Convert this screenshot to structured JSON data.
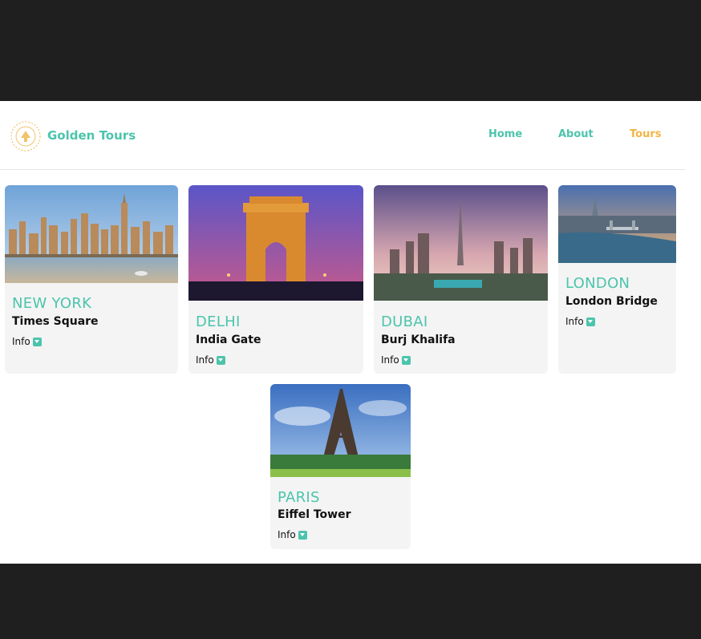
{
  "brand": {
    "name": "Golden Tours",
    "badge_text": "Golden Tours"
  },
  "nav": {
    "home": "Home",
    "about": "About",
    "tours": "Tours"
  },
  "colors": {
    "accent": "#4cc4ac",
    "active_nav": "#f2b544",
    "card_bg": "#f4f4f4"
  },
  "cards": [
    {
      "city": "NEW YORK",
      "landmark": "Times Square",
      "info": "Info",
      "icon": "chevron-down-icon"
    },
    {
      "city": "DELHI",
      "landmark": "India Gate",
      "info": "Info",
      "icon": "chevron-down-icon"
    },
    {
      "city": "DUBAI",
      "landmark": "Burj Khalifa",
      "info": "Info",
      "icon": "chevron-down-icon"
    },
    {
      "city": "LONDON",
      "landmark": "London Bridge",
      "info": "Info",
      "icon": "chevron-down-icon"
    },
    {
      "city": "PARIS",
      "landmark": "Eiffel Tower",
      "info": "Info",
      "icon": "chevron-down-icon"
    }
  ]
}
